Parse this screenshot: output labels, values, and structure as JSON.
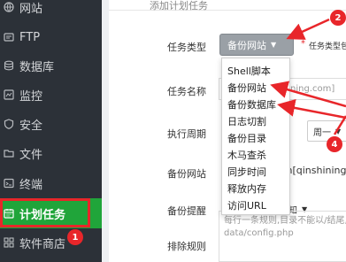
{
  "sidebar": {
    "items": [
      {
        "label": "网站",
        "icon": "globe-icon"
      },
      {
        "label": "FTP",
        "icon": "ftp-icon"
      },
      {
        "label": "数据库",
        "icon": "database-icon"
      },
      {
        "label": "监控",
        "icon": "monitor-icon"
      },
      {
        "label": "安全",
        "icon": "shield-icon"
      },
      {
        "label": "文件",
        "icon": "folder-icon"
      },
      {
        "label": "终端",
        "icon": "terminal-icon"
      },
      {
        "label": "计划任务",
        "icon": "calendar-icon"
      },
      {
        "label": "软件商店",
        "icon": "apps-icon"
      }
    ],
    "active_item": "计划任务"
  },
  "header": {
    "title": "添加计划任务"
  },
  "form": {
    "task_type_label": "任务类型",
    "task_type_value": "备份网站",
    "required_mark": "*",
    "task_type_hint": "任务类型包",
    "task_name_label": "任务名称",
    "task_name_value": "ning.com]",
    "cycle_label": "执行周期",
    "cycle_value": "周一",
    "backup_site_label": "备份网站",
    "backup_site_value": "om[qinshining.",
    "backup_notify_label": "备份提醒",
    "backup_notify_value": "息通知",
    "exclude_label": "排除规则",
    "exclude_placeholder_line1": "每行一条规则,目录不能以/结尾, 示",
    "exclude_placeholder_line2": "data/config.php"
  },
  "dropdown": {
    "options": [
      "Shell脚本",
      "备份网站",
      "备份数据库",
      "日志切割",
      "备份目录",
      "木马查杀",
      "同步时间",
      "释放内存",
      "访问URL"
    ]
  },
  "annotations": {
    "step1": "1",
    "step2": "2",
    "step4": "4",
    "color": "#e8262a"
  },
  "colors": {
    "sidebar_bg": "#2c3138",
    "active_green": "#20a53a",
    "select_gray": "#9aa0a6"
  }
}
